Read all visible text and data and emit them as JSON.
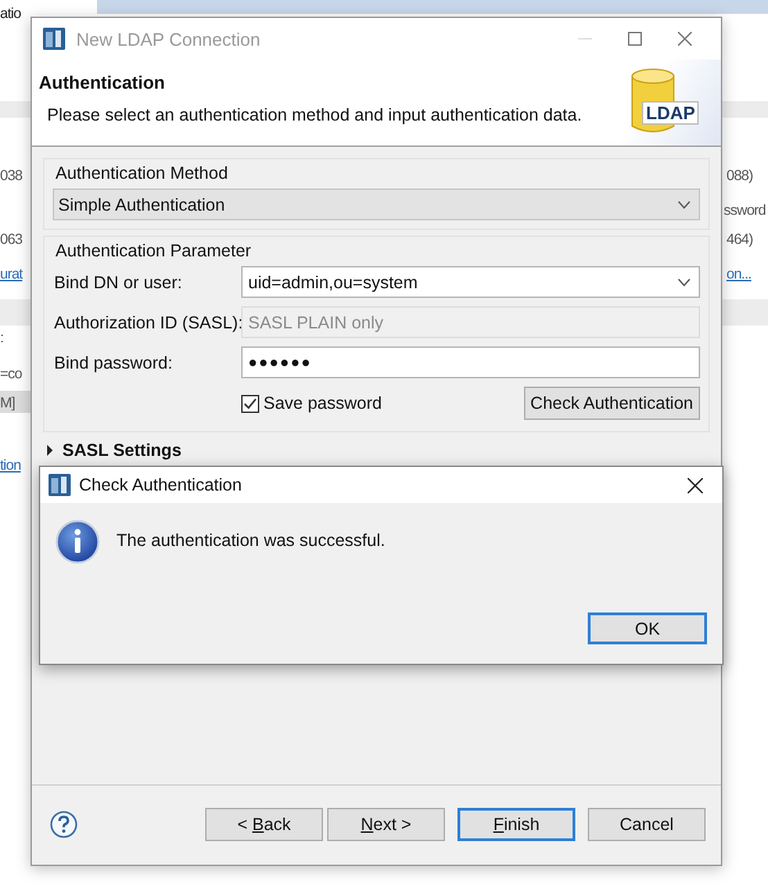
{
  "background": {
    "fragments": [
      {
        "text": "atio",
        "kind": "tab"
      },
      {
        "text": "038",
        "kind": "text"
      },
      {
        "text": "063",
        "kind": "text"
      },
      {
        "text": "urat",
        "kind": "link"
      },
      {
        "text": ":",
        "kind": "text"
      },
      {
        "text": "=co",
        "kind": "text"
      },
      {
        "text": "M]",
        "kind": "text"
      },
      {
        "text": "tion",
        "kind": "link"
      },
      {
        "text": "088)",
        "kind": "text"
      },
      {
        "text": "ssword",
        "kind": "text"
      },
      {
        "text": "464)",
        "kind": "text"
      },
      {
        "text": "on...",
        "kind": "link"
      }
    ]
  },
  "window": {
    "title": "New LDAP Connection"
  },
  "header": {
    "title": "Authentication",
    "description": "Please select an authentication method and input authentication data.",
    "logo_label": "LDAP"
  },
  "method_group": {
    "legend": "Authentication Method",
    "value": "Simple Authentication"
  },
  "parameter_group": {
    "legend": "Authentication Parameter",
    "fields": [
      {
        "label": "Bind DN or user:",
        "value": "uid=admin,ou=system",
        "kind": "combo",
        "disabled": false
      },
      {
        "label": "Authorization ID (SASL):",
        "placeholder": "SASL PLAIN only",
        "kind": "text",
        "disabled": true
      },
      {
        "label": "Bind password:",
        "value": "●●●●●●",
        "kind": "password",
        "disabled": false
      }
    ],
    "save_password": {
      "label": "Save password",
      "checked": true
    },
    "check_button": "Check Authentication"
  },
  "sasl_section": {
    "label": "SASL Settings",
    "expanded": false
  },
  "message_dialog": {
    "title": "Check Authentication",
    "message": "The authentication was successful.",
    "button": {
      "label": "OK",
      "default": true
    }
  },
  "footer_buttons": [
    {
      "label_before": "< ",
      "mnemonic": "B",
      "label_after": "ack",
      "default": false
    },
    {
      "mnemonic": "N",
      "label_after": "ext >",
      "default": false
    },
    {
      "mnemonic": "F",
      "label_after": "inish",
      "default": true
    },
    {
      "label_before": "Cancel",
      "default": false
    }
  ]
}
